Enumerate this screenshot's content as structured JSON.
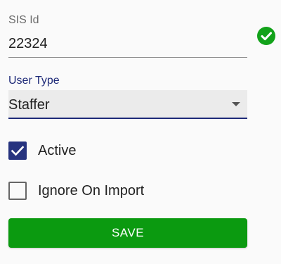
{
  "sis_id": {
    "label": "SIS Id",
    "value": "22324",
    "status_icon": "check-circle-icon",
    "status_color": "#12a21a"
  },
  "user_type": {
    "label": "User Type",
    "selected": "Staffer",
    "accent_color": "#1e2a78"
  },
  "checkboxes": [
    {
      "label": "Active",
      "checked": true
    },
    {
      "label": "Ignore On Import",
      "checked": false
    }
  ],
  "save_button": {
    "label": "SAVE",
    "color": "#0b9a10"
  }
}
